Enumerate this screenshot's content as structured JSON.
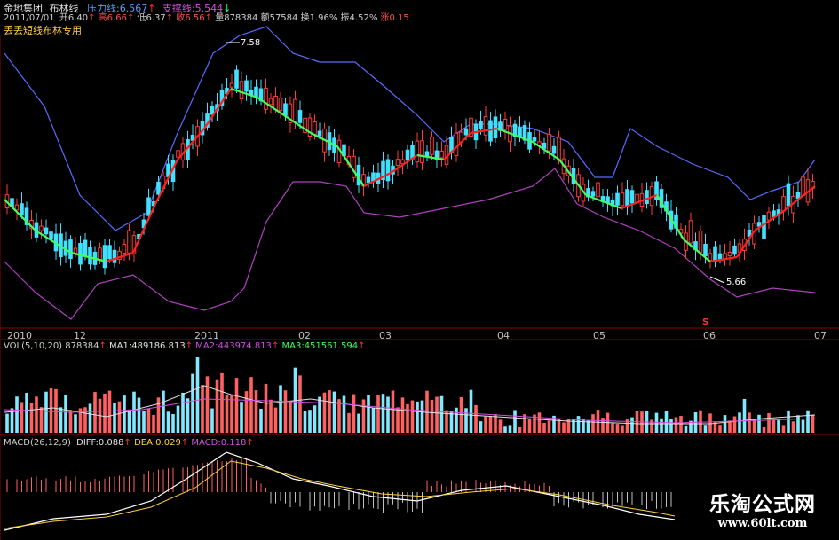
{
  "header": {
    "stock_name": "金地集团",
    "indicator_name": "布林线",
    "resistance_label": "压力线:",
    "resistance_value": "6.567",
    "support_label": "支撑线:",
    "support_value": "5.544",
    "up_arrow": "↑",
    "down_arrow": "↓",
    "date": "2011/07/01",
    "open_label": "开",
    "open_value": "6.40",
    "high_label": "高",
    "high_value": "6.66",
    "low_label": "低",
    "low_value": "6.37",
    "close_label": "收",
    "close_value": "6.56",
    "volume_label": "量",
    "volume_value": "878384",
    "amount_label": "额",
    "amount_value": "57584",
    "turnover_label": "换",
    "turnover_value": "1.96%",
    "amplitude_label": "振",
    "amplitude_value": "4.52%",
    "streak_label": "涨",
    "streak_value": "0.15",
    "formula_name": "丢丢短线布林专用"
  },
  "annotations": {
    "high_mark": "7.58",
    "low_mark": "5.66",
    "event_marker": "S"
  },
  "time_axis": [
    "2010",
    "12",
    "2011",
    "02",
    "03",
    "04",
    "05",
    "06",
    "07"
  ],
  "vol_panel": {
    "title": "VOL(5,10,20)",
    "value": "878384",
    "ma1_label": "MA1:",
    "ma1_value": "489186.813",
    "ma2_label": "MA2:",
    "ma2_value": "443974.813",
    "ma3_label": "MA3:",
    "ma3_value": "451561.594"
  },
  "macd_panel": {
    "title": "MACD(26,12,9)",
    "diff_label": "DIFF:",
    "diff_value": "0.088",
    "dea_label": "DEA:",
    "dea_value": "0.029",
    "macd_label": "MACD:",
    "macd_value": "0.118"
  },
  "watermark": {
    "title": "乐淘公式网",
    "url": "www.60lt.com"
  },
  "colors": {
    "up": "#ff3c3c",
    "down": "#40e0ff",
    "upper_band": "#5a6aff",
    "lower_band": "#b040c0",
    "mid_up": "#ff2020",
    "mid_down": "#40ff60",
    "panel_border": "#8b0000",
    "vol_up": "#ff6060",
    "vol_down": "#80e8ff"
  }
}
